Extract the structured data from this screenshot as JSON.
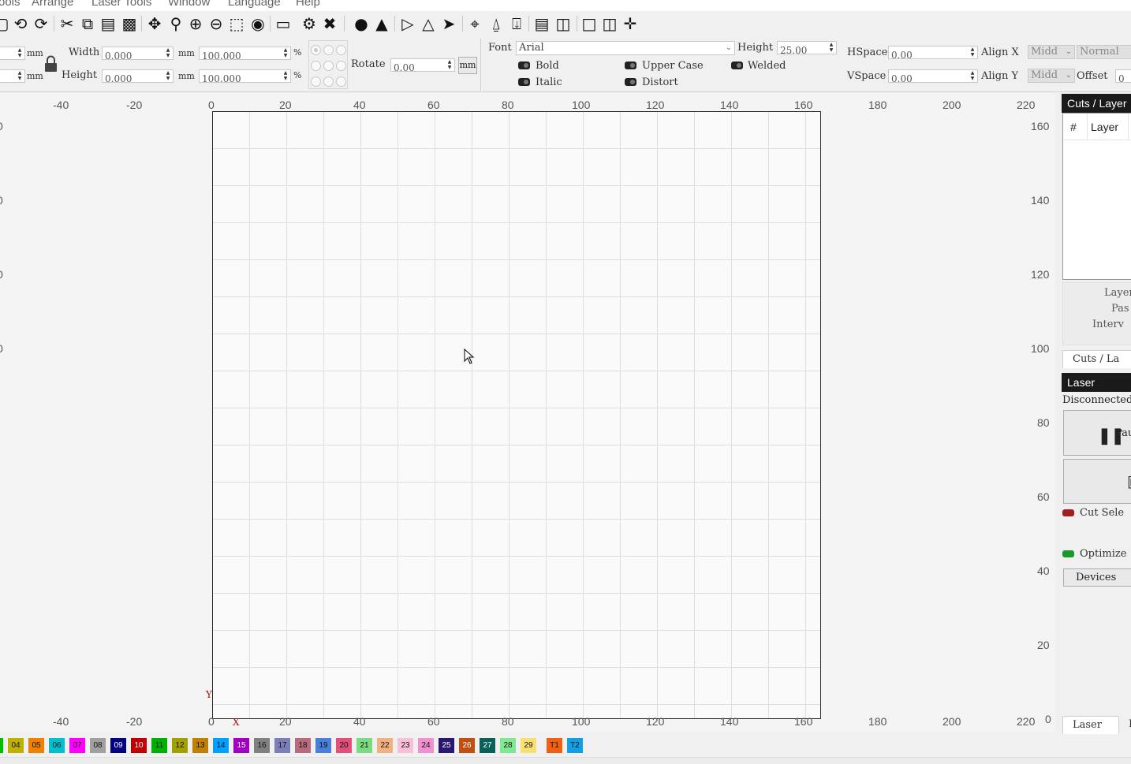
{
  "menu": [
    "ools",
    "Arrange",
    "Laser Tools",
    "Window",
    "Language",
    "Help"
  ],
  "toolbar_icons": [
    "new-icon",
    "undo-icon",
    "redo-icon",
    "cut-icon",
    "copy-icon",
    "paste-icon",
    "delete-icon",
    "move-icon",
    "zoom-icon",
    "zoom-in-icon",
    "zoom-out-icon",
    "select-rect-icon",
    "camera-icon",
    "monitor-icon",
    "settings-icon",
    "tools-icon",
    "group-icon",
    "user-icon",
    "align-icon",
    "mirror-icon",
    "send-icon",
    "target-icon",
    "align-vertical-icon",
    "align-horizontal-icon",
    "distribute-vertical-icon",
    "distribute-horizontal-icon",
    "dock-icon",
    "dock-centre-icon",
    "centre-cross-icon"
  ],
  "props": {
    "unit_mm": "mm",
    "pct": "%",
    "width_label": "Width",
    "height_label": "Height",
    "width_value": "0.000",
    "height_value": "0.000",
    "scale_w": "100.000",
    "scale_h": "100.000",
    "rotate_label": "Rotate",
    "rotate_value": "0.00",
    "mm_button": "mm",
    "font_label": "Font",
    "font_value": "Arial",
    "text_height_label": "Height",
    "text_height_value": "25.00",
    "bold": "Bold",
    "italic": "Italic",
    "upper_case": "Upper Case",
    "distort": "Distort",
    "welded": "Welded",
    "hspace_label": "HSpace",
    "hspace_value": "0.00",
    "vspace_label": "VSpace",
    "vspace_value": "0.00",
    "align_x_label": "Align X",
    "align_x_value": "Midd",
    "align_y_label": "Align Y",
    "align_y_value": "Midd",
    "normal_value": "Normal",
    "offset_label": "Offset",
    "offset_value": "0"
  },
  "ruler": {
    "top": [
      "-40",
      "-20",
      "0",
      "20",
      "40",
      "60",
      "80",
      "100",
      "120",
      "140",
      "160",
      "180",
      "200",
      "220"
    ],
    "bottom": [
      "-40",
      "-20",
      "0",
      "20",
      "40",
      "60",
      "80",
      "100",
      "120",
      "140",
      "160",
      "180",
      "200",
      "220"
    ],
    "right": [
      "160",
      "140",
      "120",
      "100",
      "80",
      "60",
      "40",
      "20",
      "0"
    ],
    "left": [
      "0",
      "0",
      "0",
      "0"
    ],
    "axis_x": "X",
    "axis_y": "Y"
  },
  "dock": {
    "cuts_title": "Cuts / Layer",
    "col_hash": "#",
    "col_layer": "Layer",
    "layer_label": "Layer",
    "passes_label": "Pas",
    "interval_label": "Interv",
    "cuts_tab": "Cuts / La",
    "laser_title": "Laser",
    "status": "Disconnected",
    "pause_button": "Pau",
    "cut_selected": "Cut Sele",
    "optimize": "Optimize",
    "devices_button": "Devices",
    "laser_tab": "Laser",
    "other_tab": "I"
  },
  "palette": [
    {
      "label": "",
      "color": "#00c000"
    },
    {
      "label": "04",
      "color": "#c0b000"
    },
    {
      "label": "05",
      "color": "#f08000"
    },
    {
      "label": "06",
      "color": "#00c0d0"
    },
    {
      "label": "07",
      "color": "#ff00ff"
    },
    {
      "label": "08",
      "color": "#a0a0a0"
    },
    {
      "label": "09",
      "color": "#000080"
    },
    {
      "label": "10",
      "color": "#c00000"
    },
    {
      "label": "11",
      "color": "#00b000"
    },
    {
      "label": "12",
      "color": "#a0a000"
    },
    {
      "label": "13",
      "color": "#c08000"
    },
    {
      "label": "14",
      "color": "#00a0ff"
    },
    {
      "label": "15",
      "color": "#a000c0"
    },
    {
      "label": "16",
      "color": "#808080"
    },
    {
      "label": "17",
      "color": "#7d7db8"
    },
    {
      "label": "18",
      "color": "#b86b7d"
    },
    {
      "label": "19",
      "color": "#4a7ed8"
    },
    {
      "label": "20",
      "color": "#e0507a"
    },
    {
      "label": "21",
      "color": "#7adb80"
    },
    {
      "label": "22",
      "color": "#f0b080"
    },
    {
      "label": "23",
      "color": "#f8c0d8"
    },
    {
      "label": "24",
      "color": "#f090d0"
    },
    {
      "label": "25",
      "color": "#2a1870"
    },
    {
      "label": "26",
      "color": "#c05010"
    },
    {
      "label": "27",
      "color": "#0a6058"
    },
    {
      "label": "28",
      "color": "#80e890"
    },
    {
      "label": "29",
      "color": "#f8e070"
    },
    {
      "label": "T1",
      "color": "#f06010"
    },
    {
      "label": "T2",
      "color": "#10a0e8"
    }
  ]
}
